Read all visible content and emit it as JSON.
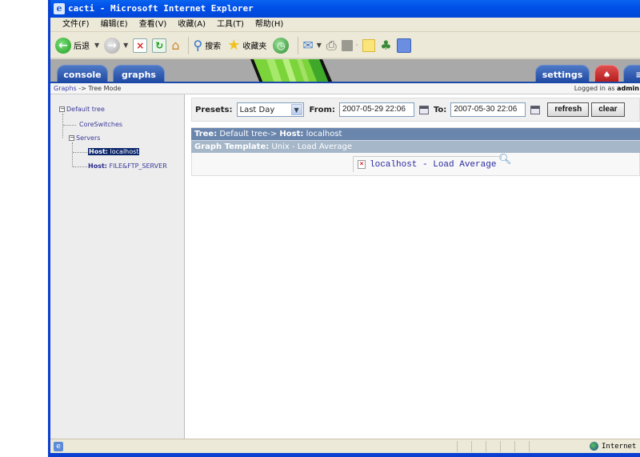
{
  "window": {
    "title": "cacti - Microsoft Internet Explorer"
  },
  "menu": [
    "文件(F)",
    "编辑(E)",
    "查看(V)",
    "收藏(A)",
    "工具(T)",
    "帮助(H)"
  ],
  "toolbar": {
    "back_label": "后退",
    "search_label": "搜索",
    "favorites_label": "收藏夹"
  },
  "cacti": {
    "tabs": {
      "console": "console",
      "graphs": "graphs",
      "settings": "settings"
    },
    "breadcrumb": {
      "link": "Graphs",
      "separator": " -> ",
      "current": "Tree Mode"
    },
    "login": {
      "prefix": "Logged in as ",
      "user": "admin"
    },
    "tree": {
      "root": "Default tree",
      "items": [
        {
          "label": "CoreSwitches"
        },
        {
          "label": "Servers"
        }
      ],
      "hosts": [
        {
          "prefix": "Host:",
          "name": "localhost",
          "selected": true
        },
        {
          "prefix": "Host:",
          "name": "FILE&FTP_SERVER",
          "selected": false
        }
      ]
    },
    "filter": {
      "presets_label": "Presets:",
      "preset_value": "Last Day",
      "from_label": "From:",
      "from_value": "2007-05-29 22:06",
      "to_label": "To:",
      "to_value": "2007-05-30 22:06",
      "refresh_label": "refresh",
      "clear_label": "clear"
    },
    "tree_header": {
      "tree_label": "Tree:",
      "tree_value": "Default tree->",
      "host_label": "Host:",
      "host_value": "localhost"
    },
    "template_header": {
      "label": "Graph Template:",
      "value": "Unix - Load Average"
    },
    "graph": {
      "title": "localhost - Load Average"
    }
  },
  "status": {
    "zone": "Internet"
  }
}
